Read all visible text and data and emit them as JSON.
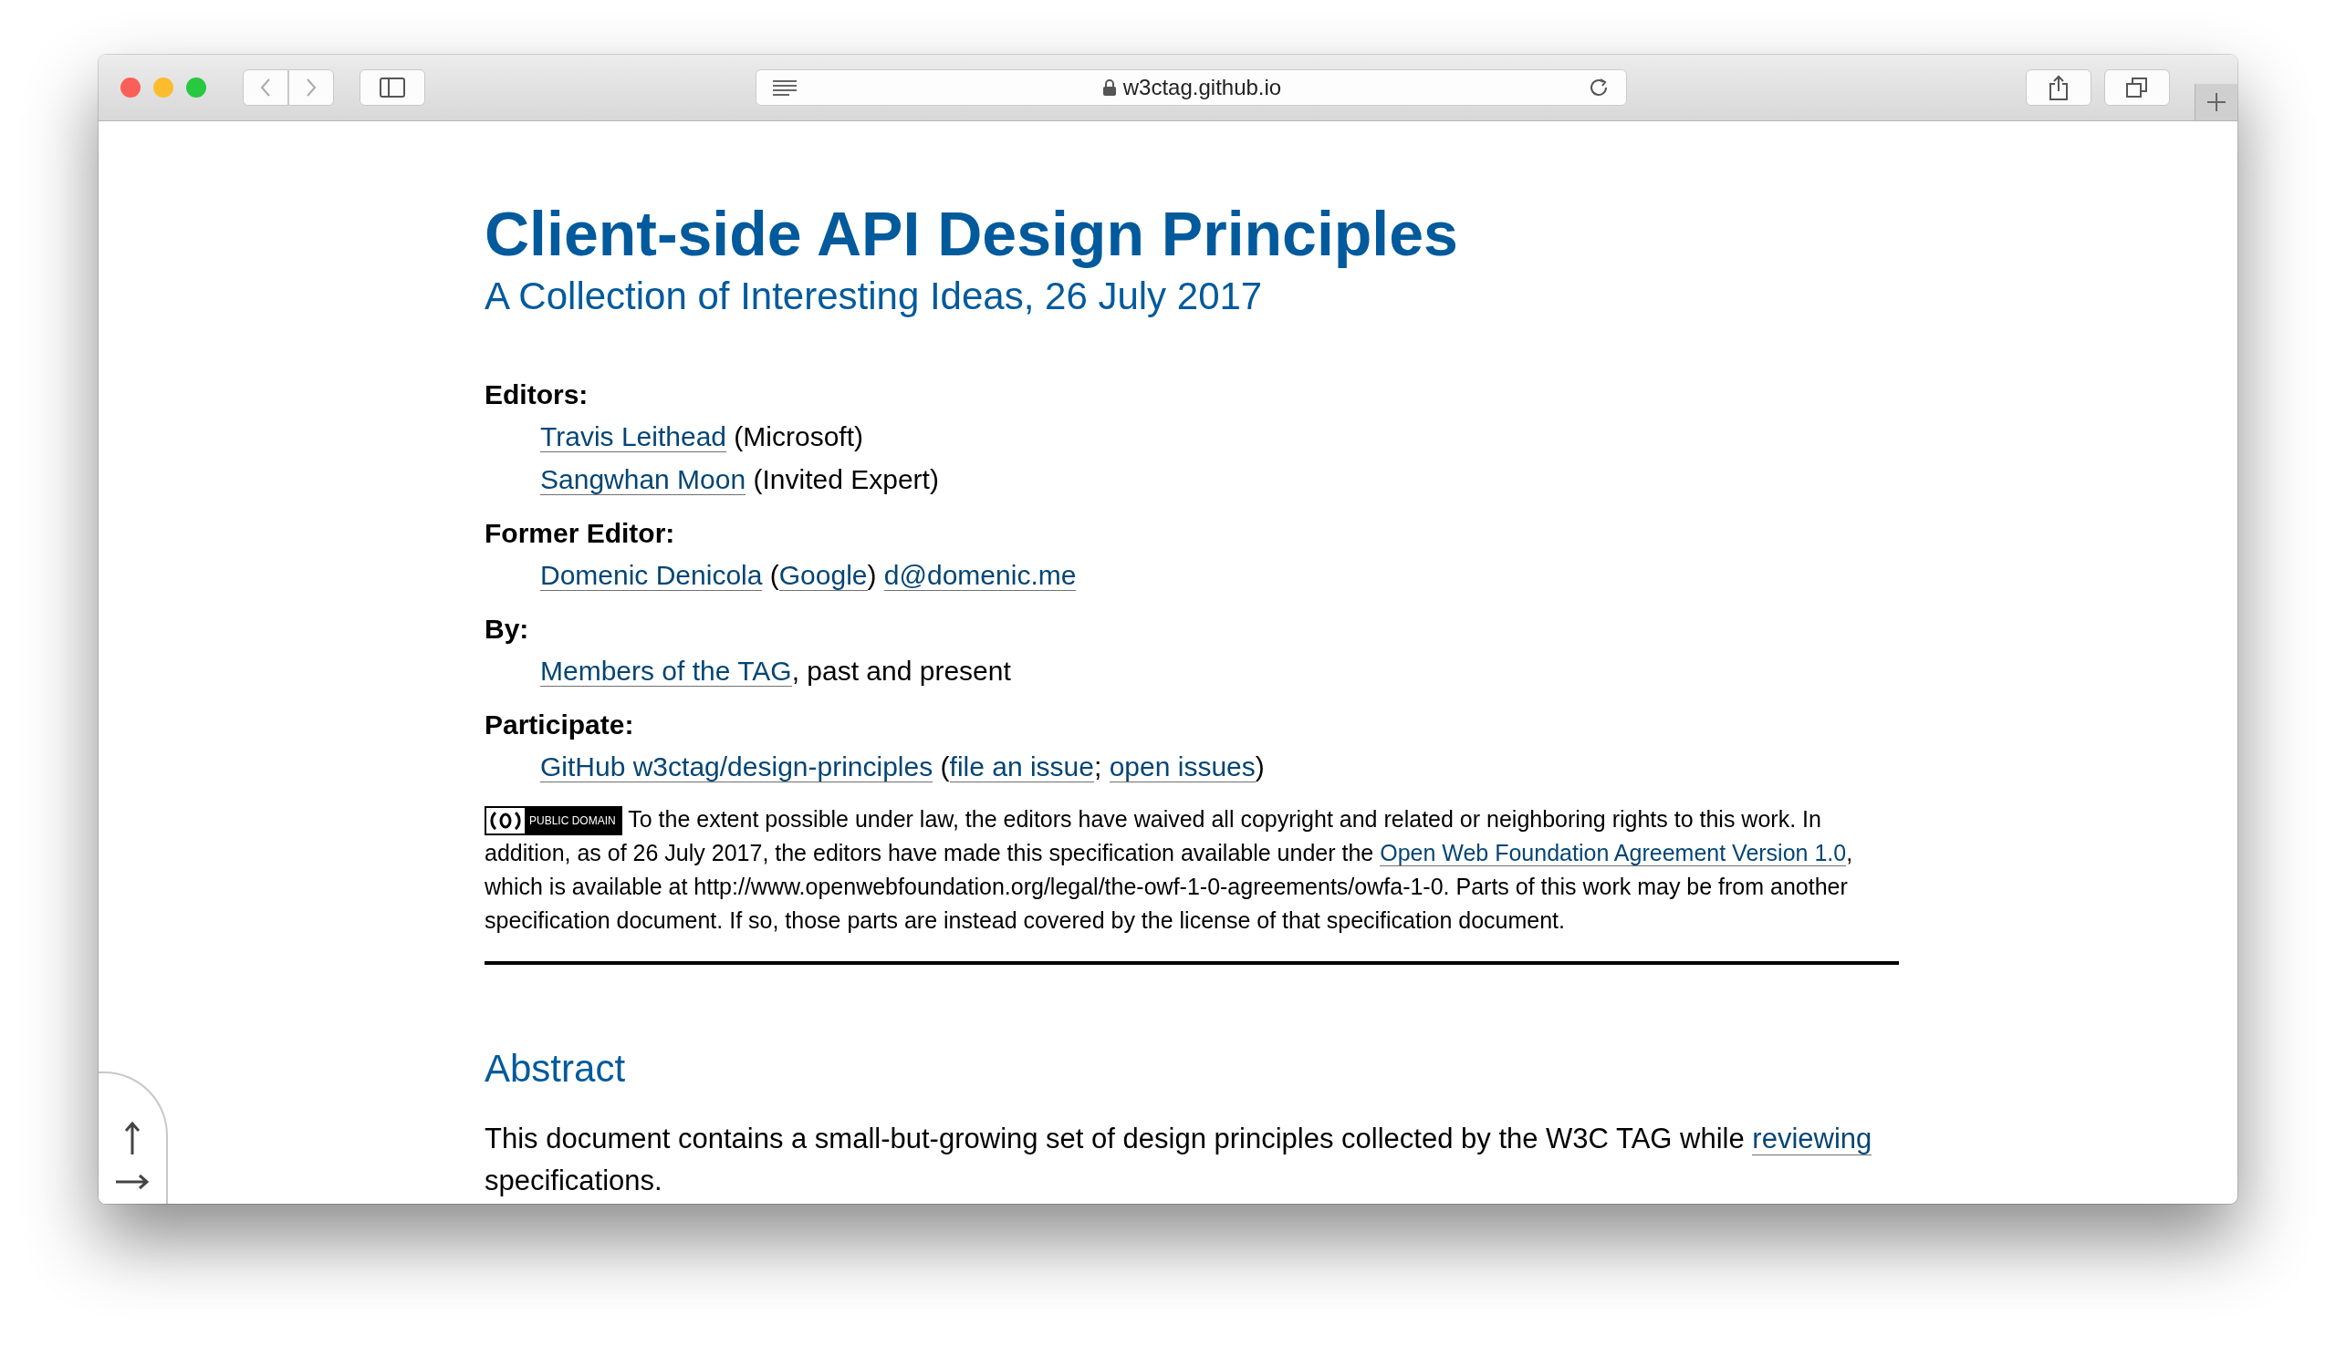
{
  "browser": {
    "address": "w3ctag.github.io"
  },
  "title": "Client-side API Design Principles",
  "subtitle": "A Collection of Interesting Ideas, 26 July 2017",
  "metadata": [
    {
      "label": "Editors:",
      "entries": [
        [
          {
            "kind": "link",
            "text": "Travis Leithead"
          },
          {
            "kind": "text",
            "text": " (Microsoft)"
          }
        ],
        [
          {
            "kind": "link",
            "text": "Sangwhan Moon"
          },
          {
            "kind": "text",
            "text": " (Invited Expert)"
          }
        ]
      ]
    },
    {
      "label": "Former Editor:",
      "entries": [
        [
          {
            "kind": "link",
            "text": "Domenic Denicola"
          },
          {
            "kind": "text",
            "text": " ("
          },
          {
            "kind": "link",
            "text": "Google"
          },
          {
            "kind": "text",
            "text": ") "
          },
          {
            "kind": "link",
            "text": "d@domenic.me"
          }
        ]
      ]
    },
    {
      "label": "By:",
      "entries": [
        [
          {
            "kind": "link",
            "text": "Members of the TAG"
          },
          {
            "kind": "text",
            "text": ", past and present"
          }
        ]
      ]
    },
    {
      "label": "Participate:",
      "entries": [
        [
          {
            "kind": "link",
            "text": "GitHub w3ctag/design-principles"
          },
          {
            "kind": "text",
            "text": " ("
          },
          {
            "kind": "link",
            "text": "file an issue"
          },
          {
            "kind": "text",
            "text": "; "
          },
          {
            "kind": "link",
            "text": "open issues"
          },
          {
            "kind": "text",
            "text": ")"
          }
        ]
      ]
    }
  ],
  "license": {
    "badge_text": "PUBLIC DOMAIN",
    "segments": [
      {
        "kind": "text",
        "text": " To the extent possible under law, the editors have waived all copyright and related or neighboring rights to this work. In addition, as of 26 July 2017, the editors have made this specification available under the "
      },
      {
        "kind": "link",
        "text": "Open Web Foundation Agreement Version 1.0"
      },
      {
        "kind": "text",
        "text": ", which is available at http://www.openwebfoundation.org/legal/the-owf-1-0-agreements/owfa-1-0. Parts of this work may be from another specification document. If so, those parts are instead covered by the license of that specification document."
      }
    ]
  },
  "abstract": {
    "heading": "Abstract",
    "segments": [
      {
        "kind": "text",
        "text": "This document contains a small-but-growing set of design principles collected by the W3C TAG while "
      },
      {
        "kind": "link",
        "text": "reviewing"
      },
      {
        "kind": "text",
        "text": " specifications."
      }
    ]
  }
}
